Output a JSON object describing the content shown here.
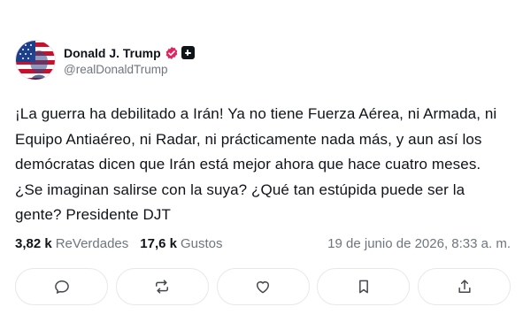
{
  "author": {
    "display_name": "Donald J. Trump",
    "handle": "@realDonaldTrump"
  },
  "post": {
    "text": "¡La guerra ha debilitado a Irán! Ya no tiene Fuerza Aérea, ni Armada, ni Equipo Antiaéreo, ni Radar, ni prácticamente nada más, y aun así los demócratas dicen que Irán está mejor ahora que hace cuatro meses. ¿Se imaginan salirse con la suya? ¿Qué tan estúpida puede ser la gente? Presidente DJT"
  },
  "stats": {
    "reposts_count": "3,82 k",
    "reposts_label": "ReVerdades",
    "likes_count": "17,6 k",
    "likes_label": "Gustos",
    "timestamp": "19 de junio de 2026, 8:33 a. m."
  },
  "actions": [
    {
      "icon": "reply-icon"
    },
    {
      "icon": "repost-icon"
    },
    {
      "icon": "like-heart-icon"
    },
    {
      "icon": "bookmark-icon"
    },
    {
      "icon": "share-icon"
    }
  ],
  "colors": {
    "text": "#0f1419",
    "secondary_text": "#6e767d",
    "verified_badge": "#e0245e",
    "border": "#e6e8ea"
  }
}
